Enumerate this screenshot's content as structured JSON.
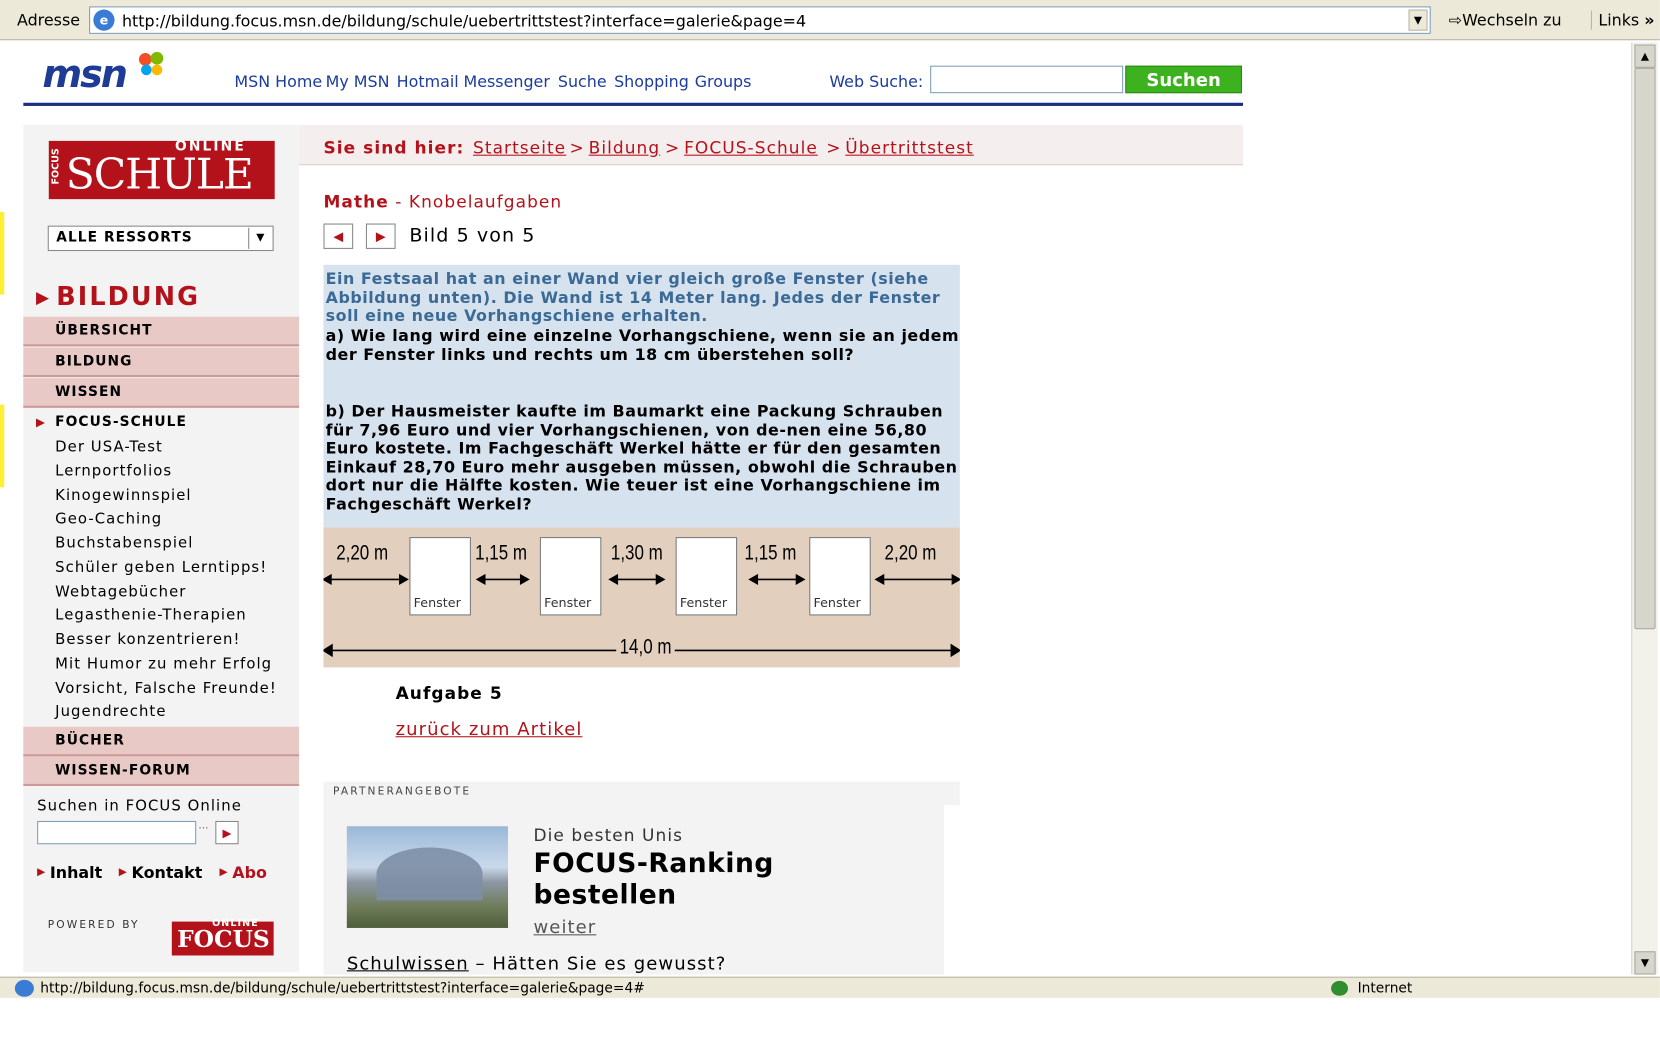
{
  "browser": {
    "address_label": "Adresse",
    "url": "http://bildung.focus.msn.de/bildung/schule/uebertrittstest?interface=galerie&page=4",
    "go_label": "Wechseln zu",
    "links_label": "Links",
    "status_url": "http://bildung.focus.msn.de/bildung/schule/uebertrittstest?interface=galerie&page=4#",
    "status_zone": "Internet"
  },
  "msn": {
    "logo": "msn",
    "nav": [
      "MSN Home",
      "My MSN",
      "Hotmail",
      "Messenger",
      "Suche",
      "Shopping",
      "Groups"
    ],
    "websearch_label": "Web Suche:",
    "search_button": "Suchen"
  },
  "sidebar": {
    "logo_online": "ONLINE",
    "logo_schule": "SCHULE",
    "logo_focus": "FOCUS",
    "ressorts": "ALLE RESSORTS",
    "section": "BILDUNG",
    "categories": [
      "ÜBERSICHT",
      "BILDUNG",
      "WISSEN"
    ],
    "active": "FOCUS-SCHULE",
    "links": [
      "Der USA-Test",
      "Lernportfolios",
      "Kinogewinnspiel",
      "Geo-Caching",
      "Buchstabenspiel",
      "Schüler geben Lerntipps!",
      "Webtagebücher",
      "Legasthenie-Therapien",
      "Besser konzentrieren!",
      "Mit Humor zu mehr Erfolg",
      "Vorsicht, Falsche Freunde!",
      "Jugendrechte"
    ],
    "categories2": [
      "BÜCHER",
      "WISSEN-FORUM"
    ],
    "search_label": "Suchen in FOCUS Online",
    "footer_links": [
      "Inhalt",
      "Kontakt",
      "Abo"
    ],
    "powered_by": "POWERED BY",
    "focus_small": "FOCUS",
    "focus_small_online": "ONLINE"
  },
  "breadcrumb": {
    "label": "Sie sind hier:",
    "items": [
      "Startseite",
      "Bildung",
      "FOCUS-Schule",
      "Übertrittstest"
    ],
    "sep": ">"
  },
  "gallery": {
    "subject": "Mathe",
    "title_rest": " - Knobelaufgaben",
    "page_label": "Bild 5 von 5",
    "task_intro": "Ein Festsaal hat an einer Wand vier gleich große Fenster (siehe Abbildung unten). Die Wand ist 14 Meter lang. Jedes der Fenster soll eine neue Vorhangschiene erhalten.",
    "task_a": "a) Wie lang wird eine einzelne Vorhangschiene, wenn sie an jedem der Fenster links und rechts um 18 cm überstehen soll?",
    "task_b": "b) Der Hausmeister kaufte im Baumarkt eine Packung Schrauben für 7,96 Euro und vier Vorhangschienen, von de-nen eine 56,80 Euro kostete. Im Fachgeschäft Werkel hätte er für den gesamten Einkauf 28,70 Euro mehr ausgeben müssen, obwohl die Schrauben dort nur die Hälfte kosten. Wie teuer ist eine Vorhangschiene im Fachgeschäft Werkel?",
    "window_label": "Fenster",
    "dims": [
      "2,20 m",
      "1,15 m",
      "1,30 m",
      "1,15 m",
      "2,20 m"
    ],
    "total": "14,0 m",
    "caption": "Aufgabe 5",
    "back_link": "zurück zum Artikel"
  },
  "partner": {
    "label": "PARTNERANGEBOTE",
    "kicker": "Die besten Unis",
    "title": "FOCUS-Ranking bestellen",
    "more": "weiter",
    "schulwissen_link": "Schulwissen",
    "schulwissen_rest": " – Hätten Sie es gewusst?"
  }
}
